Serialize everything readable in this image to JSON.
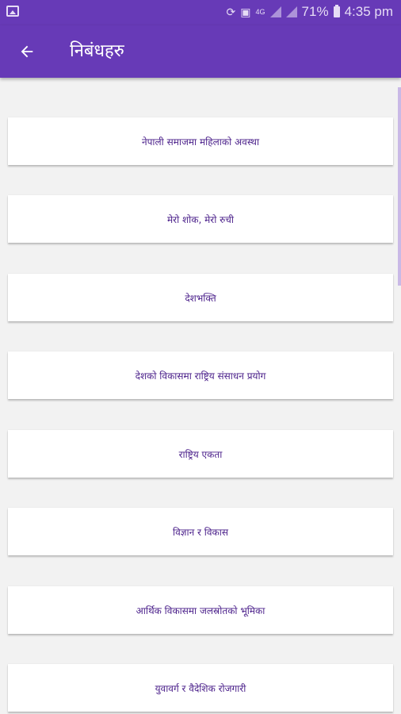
{
  "status_bar": {
    "battery_percent": "71%",
    "time": "4:35 pm",
    "network_label": "4G"
  },
  "app_bar": {
    "title": "निबंधहरु"
  },
  "essays": [
    "नेपाली समाजमा महिलाको अवस्था",
    "मेरो शोक, मेरो रुची",
    "देशभक्ति",
    "देशको विकासमा राष्ट्रिय संसाधन प्रयोग",
    "राष्ट्रिय एकता",
    "विज्ञान र विकास",
    "आर्थिक विकासमा जलस्रोतको भूमिका",
    "युवावर्ग र वैदेशिक रोजगारी"
  ],
  "colors": {
    "primary": "#673ab7",
    "card_text": "#4a1f8a",
    "background": "#f2f2f2"
  }
}
